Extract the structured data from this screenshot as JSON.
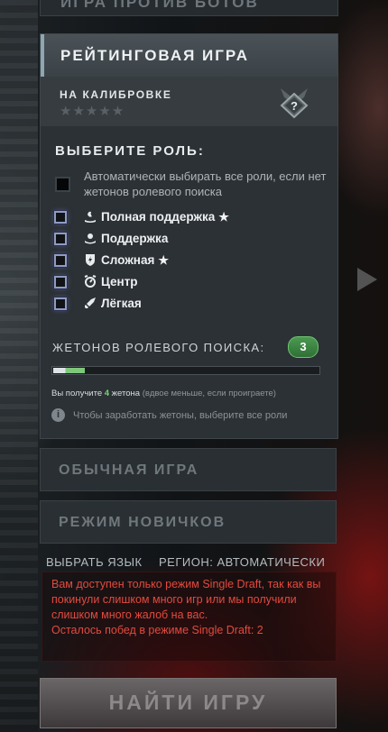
{
  "top_tab": {
    "label": "ИГРА ПРОТИВ БОТОВ"
  },
  "ranked": {
    "title": "РЕЙТИНГОВАЯ ИГРА",
    "calibration_label": "НА КАЛИБРОВКЕ",
    "stars": "★★★★★",
    "rank_badge_icon": "unknown-rank-icon",
    "select_role_title": "ВЫБЕРИТЕ РОЛЬ:",
    "auto_select_text": "Автоматически выбирать все роли, если нет жетонов ролевого поиска",
    "roles": [
      {
        "label": "Полная поддержка",
        "icon": "hard-support-icon",
        "star": "★"
      },
      {
        "label": "Поддержка",
        "icon": "support-icon",
        "star": ""
      },
      {
        "label": "Сложная",
        "icon": "offlane-icon",
        "star": "★"
      },
      {
        "label": "Центр",
        "icon": "mid-icon",
        "star": ""
      },
      {
        "label": "Лёгкая",
        "icon": "safe-lane-icon",
        "star": ""
      }
    ],
    "tokens_title": "ЖЕТОНОВ РОЛЕВОГО ПОИСКА:",
    "tokens_count": "3",
    "tokens_progress": 0.12,
    "earn_prefix": "Вы получите ",
    "earn_count": "4",
    "earn_mid": " жетона ",
    "earn_soft": "(вдвое меньше, если проиграете)",
    "info_icon": "i",
    "info_text": "Чтобы заработать жетоны, выберите все роли"
  },
  "normal_game": {
    "label": "ОБЫЧНАЯ ИГРА"
  },
  "newbie_mode": {
    "label": "РЕЖИМ НОВИЧКОВ"
  },
  "options": {
    "language": "ВЫБРАТЬ ЯЗЫК",
    "region": "РЕГИОН: АВТОМАТИЧЕСКИ"
  },
  "warning": {
    "line1": "Вам доступен только режим Single Draft, так как вы покинули слишком много игр или мы получили слишком много жалоб на вас.",
    "line2": "Осталось побед в режиме Single Draft: 2"
  },
  "find_game": {
    "label": "НАЙТИ ИГРУ"
  },
  "colors": {
    "accent_green": "#7ad46f",
    "warning_red": "#e24a3e",
    "role_checkbox_glow": "#8f9bc0"
  }
}
